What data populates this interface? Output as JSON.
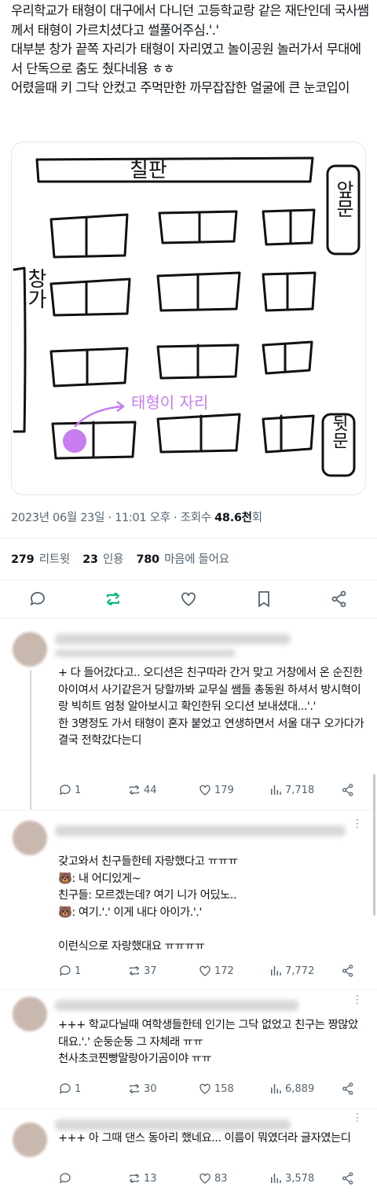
{
  "tweet": {
    "text": "우리학교가 태형이 대구에서 다니던 고등학교랑 같은 재단인데 국사쌤께서 태형이 가르치셨다고 썰풀어주심.'.'\n대부분 창가 끝쪽 자리가 태형이 자리였고 놀이공원 놀러가서 무대에서 단독으로 춤도 췄다네용 ㅎㅎ\n어렸을때 키 그닥 안컸고 주먹만한 까무잡잡한 얼굴에 큰 눈코입이",
    "drawing": {
      "board_label": "칠판",
      "front_door_label": "앞문",
      "back_door_label": "뒷문",
      "window_label": "창가",
      "seat_label": "태형이 자리"
    },
    "date": "2023년 06월 23일 · 11:01 오후 · 조회수",
    "views": "48.6천",
    "views_suffix": "회",
    "retweets": "279",
    "retweets_label": "리트윗",
    "quotes": "23",
    "quotes_label": "인용",
    "likes": "780",
    "likes_label": "마음에 들어요"
  },
  "replies": [
    {
      "text": "+ 다 들어갔다고.. 오디션은 친구따라 간거 맞고 거창에서 온 순진한 아이여서 사기같은거 당할까봐 교무실 쌤들 총동원 하셔서 방시혁이랑 빅히트 엄청 알아보시고 확인한뒤 오디션 보내셨대...'.'\n한 3명정도 가서 태형이 혼자 붙었고 연생하면서 서울 대구 오가다가 결국 전학갔다는디",
      "reply_count": "1",
      "retweet_count": "44",
      "like_count": "179",
      "view_count": "7,718"
    },
    {
      "text": "갖고와서 친구들한테 자랑했다고 ㅠㅠㅠ\n🐻: 내 어디있게~\n친구들: 모르겠는데? 여기 니가 어딨노..\n🐻: 여기.'.' 이게 내다 아이가.'.'\n\n이런식으로 자랑했대요 ㅠㅠㅠㅠ",
      "reply_count": "1",
      "retweet_count": "37",
      "like_count": "172",
      "view_count": "7,772"
    },
    {
      "text": "+++ 학교다닐때 여학생들한테 인기는 그닥 없었고 친구는 짱많았대요.'.' 순둥순둥 그 자체래 ㅠㅠ\n천사초코찐빵말랑아기곰이야 ㅠㅠ",
      "reply_count": "1",
      "retweet_count": "30",
      "like_count": "158",
      "view_count": "6,889"
    },
    {
      "text": "+++ 아 그때 댄스 동아리 했네요... 이름이 뭐였더라 글자였는디",
      "reply_count": "",
      "retweet_count": "13",
      "like_count": "83",
      "view_count": "3,578"
    }
  ],
  "colors": {
    "accent": "#00ba7c",
    "seat_dot": "#c77df0",
    "icon": "#536471"
  }
}
